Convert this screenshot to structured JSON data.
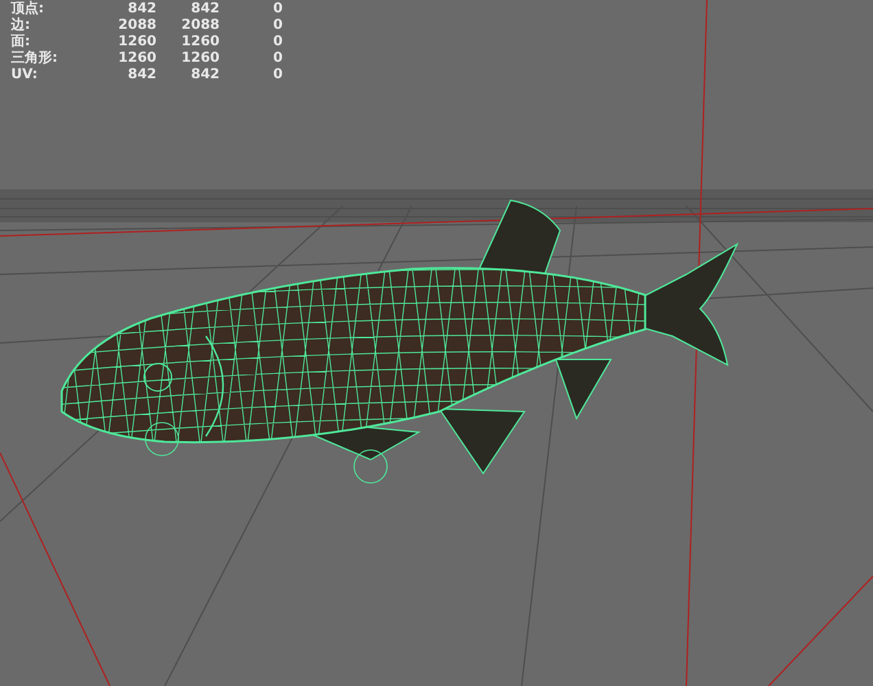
{
  "hud": {
    "rows": [
      {
        "label": "顶点:",
        "col_1": "842",
        "col_2": "842",
        "col_3": "0"
      },
      {
        "label": "边:",
        "col_1": "2088",
        "col_2": "2088",
        "col_3": "0"
      },
      {
        "label": "面:",
        "col_1": "1260",
        "col_2": "1260",
        "col_3": "0"
      },
      {
        "label": "三角形:",
        "col_1": "1260",
        "col_2": "1260",
        "col_3": "0"
      },
      {
        "label": "UV:",
        "col_1": "842",
        "col_2": "842",
        "col_3": "0"
      }
    ]
  }
}
